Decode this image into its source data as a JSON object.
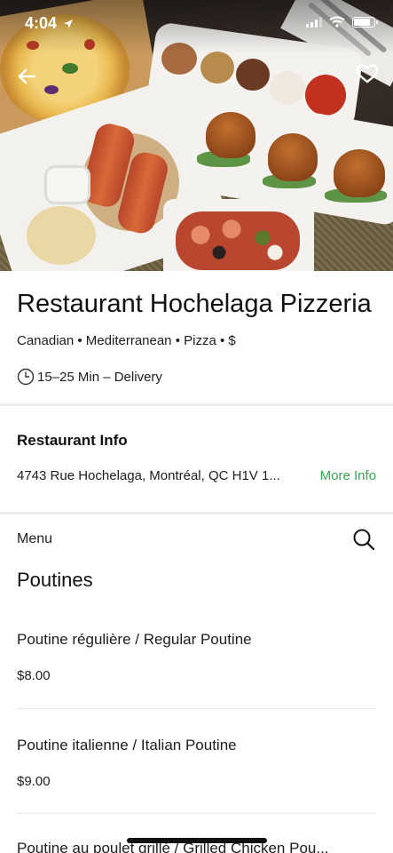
{
  "status_bar": {
    "time": "4:04"
  },
  "icons": {
    "back": "back-arrow-icon",
    "favorite": "heart-icon",
    "location": "location-arrow-icon",
    "clock": "clock-icon",
    "search": "search-icon"
  },
  "restaurant": {
    "name": "Restaurant Hochelaga Pizzeria",
    "categories": "Canadian • Mediterranean • Pizza • $",
    "delivery_time": "15–25 Min – Delivery"
  },
  "info": {
    "heading": "Restaurant Info",
    "address": "4743 Rue Hochelaga, Montréal, QC H1V 1...",
    "more_info_label": "More Info"
  },
  "menu": {
    "label": "Menu",
    "section_title": "Poutines",
    "items": [
      {
        "name": "Poutine régulière / Regular Poutine",
        "price": "$8.00"
      },
      {
        "name": "Poutine italienne / Italian Poutine",
        "price": "$9.00"
      },
      {
        "name": "Poutine au poulet grillé / Grilled Chicken Pou...",
        "price": ""
      }
    ]
  },
  "colors": {
    "accent_green": "#32a852",
    "divider": "#eeeeee"
  }
}
